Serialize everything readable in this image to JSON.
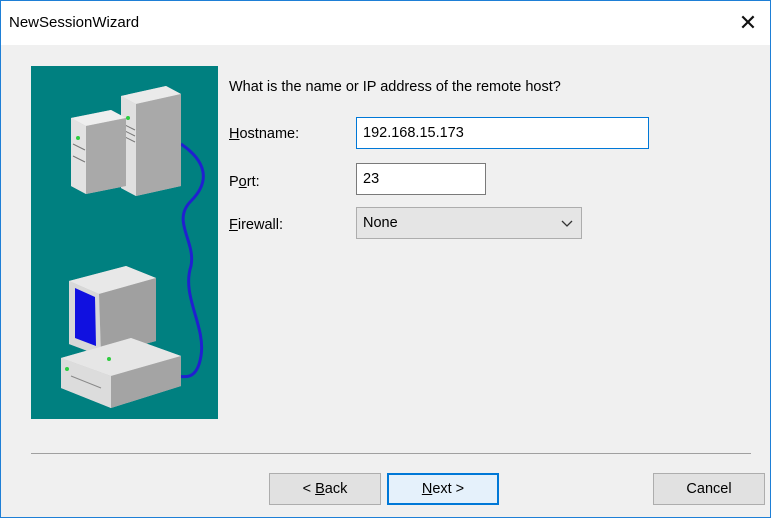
{
  "window": {
    "title": "NewSessionWizard",
    "close_glyph": "✕"
  },
  "prompt": {
    "question": "What is the name or IP address of the remote host?"
  },
  "fields": {
    "hostname": {
      "label_mnemonic": "H",
      "label_rest": "ostname:",
      "value": "192.168.15.173"
    },
    "port": {
      "label_before": "P",
      "label_mnemonic": "o",
      "label_rest": "rt:",
      "value": "23"
    },
    "firewall": {
      "label_mnemonic": "F",
      "label_rest": "irewall:",
      "selected": "None"
    }
  },
  "buttons": {
    "back": {
      "prefix": "< ",
      "mnemonic": "B",
      "rest": "ack"
    },
    "next": {
      "mnemonic": "N",
      "rest": "ext >"
    },
    "cancel": {
      "label": "Cancel"
    }
  },
  "colors": {
    "illustration_bg": "#008080",
    "accent": "#0078d7"
  },
  "icons": {
    "illustration": "server-to-computer-illustration",
    "dropdown": "chevron-down-icon",
    "close": "close-icon"
  }
}
